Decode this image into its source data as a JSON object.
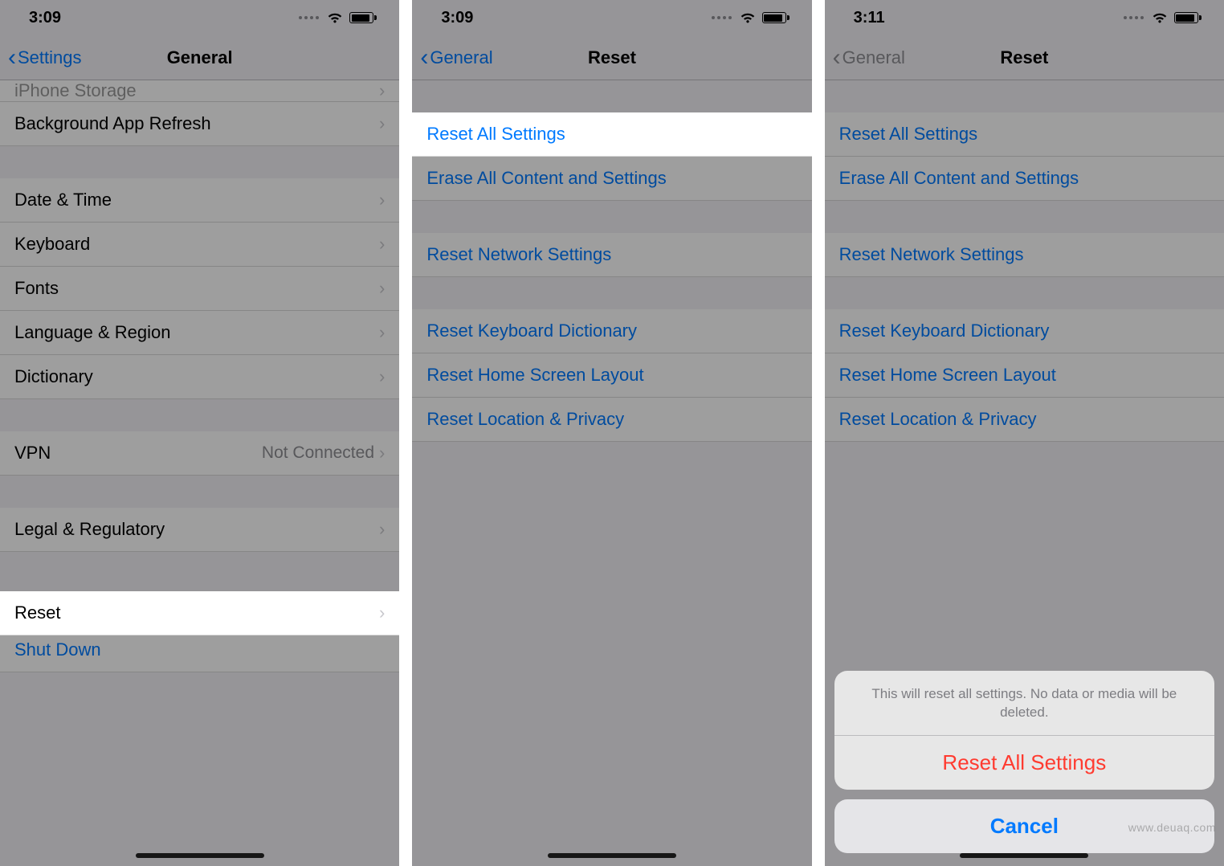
{
  "watermark": "www.deuaq.com",
  "panel1": {
    "time": "3:09",
    "back_label": "Settings",
    "title": "General",
    "items_top": [
      {
        "label": "iPhone Storage",
        "truncated": true
      },
      {
        "label": "Background App Refresh"
      }
    ],
    "items_mid": [
      {
        "label": "Date & Time"
      },
      {
        "label": "Keyboard"
      },
      {
        "label": "Fonts"
      },
      {
        "label": "Language & Region"
      },
      {
        "label": "Dictionary"
      }
    ],
    "vpn": {
      "label": "VPN",
      "detail": "Not Connected"
    },
    "legal": {
      "label": "Legal & Regulatory"
    },
    "reset": {
      "label": "Reset"
    },
    "shutdown": {
      "label": "Shut Down"
    }
  },
  "panel2": {
    "time": "3:09",
    "back_label": "General",
    "title": "Reset",
    "group1": [
      {
        "label": "Reset All Settings",
        "highlight": true
      },
      {
        "label": "Erase All Content and Settings"
      }
    ],
    "group2": [
      {
        "label": "Reset Network Settings"
      }
    ],
    "group3": [
      {
        "label": "Reset Keyboard Dictionary"
      },
      {
        "label": "Reset Home Screen Layout"
      },
      {
        "label": "Reset Location & Privacy"
      }
    ]
  },
  "panel3": {
    "time": "3:11",
    "back_label": "General",
    "title": "Reset",
    "group1": [
      {
        "label": "Reset All Settings"
      },
      {
        "label": "Erase All Content and Settings"
      }
    ],
    "group2": [
      {
        "label": "Reset Network Settings"
      }
    ],
    "group3": [
      {
        "label": "Reset Keyboard Dictionary"
      },
      {
        "label": "Reset Home Screen Layout"
      },
      {
        "label": "Reset Location & Privacy"
      }
    ],
    "sheet": {
      "message": "This will reset all settings. No data or media will be deleted.",
      "destructive": "Reset All Settings",
      "cancel": "Cancel"
    }
  }
}
